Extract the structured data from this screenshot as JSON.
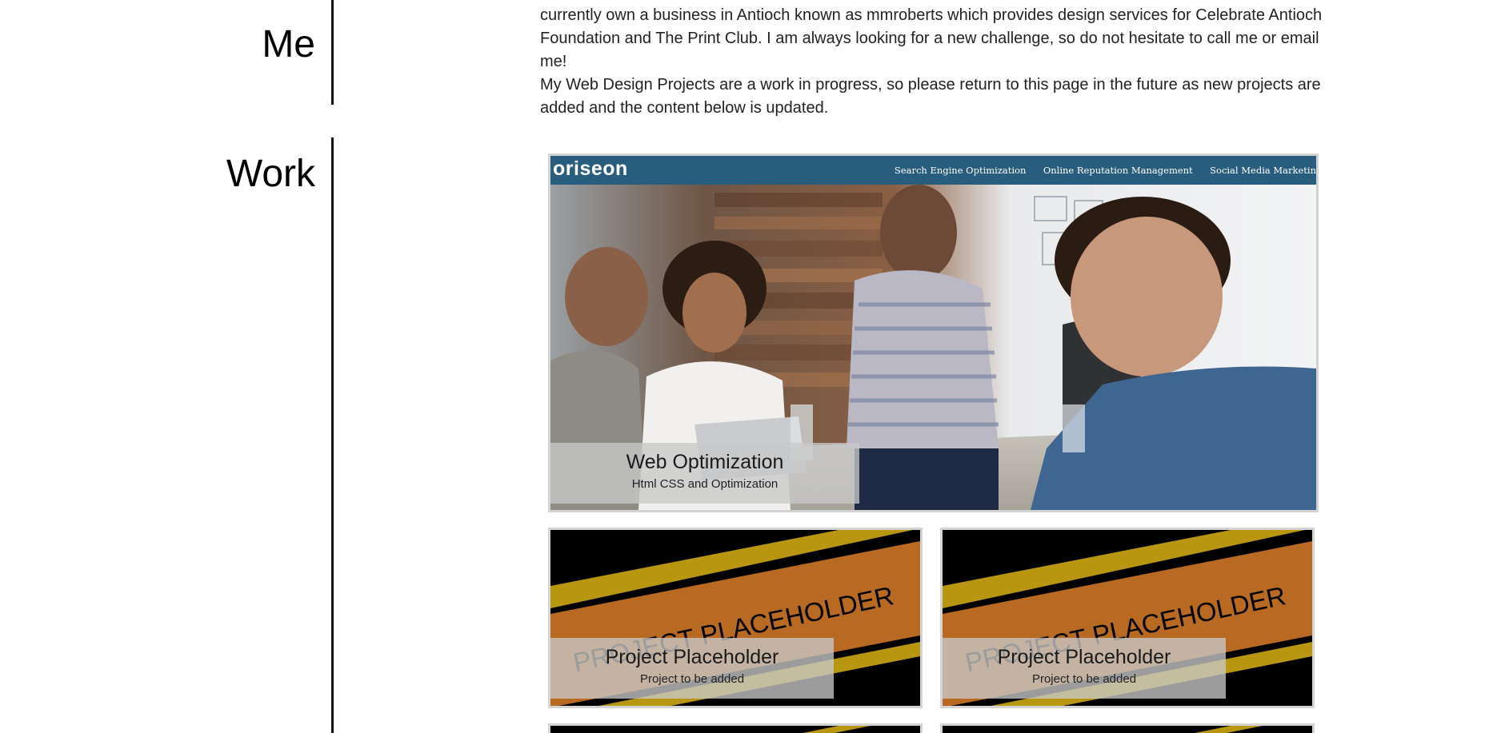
{
  "sections": {
    "me_title": "Me",
    "work_title": "Work"
  },
  "about": {
    "line1": "currently own a business in Antioch known as mmroberts which provides design services for Celebrate Antioch",
    "line2": "Foundation and The Print Club. I am always looking for a new challenge, so do not hesitate to call me or email me!",
    "line3": "My Web Design Projects are a work in progress, so please return to this page in the future as new projects are",
    "line4": "added and the content below is updated."
  },
  "featured": {
    "site_logo": "oriseon",
    "nav": [
      "Search Engine Optimization",
      "Online Reputation Management",
      "Social Media Marketin"
    ],
    "title": "Web Optimization",
    "subtitle": "Html CSS and Optimization",
    "header_color": "#285d7d"
  },
  "placeholders": [
    {
      "banner_text": "PROJECT PLACEHOLDER",
      "title": "Project Placeholder",
      "subtitle": "Project to be added"
    },
    {
      "banner_text": "PROJECT PLACEHOLDER",
      "title": "Project Placeholder",
      "subtitle": "Project to be added"
    }
  ],
  "colors": {
    "stripe_gold": "#b8960f",
    "stripe_orange": "#b86a22"
  }
}
